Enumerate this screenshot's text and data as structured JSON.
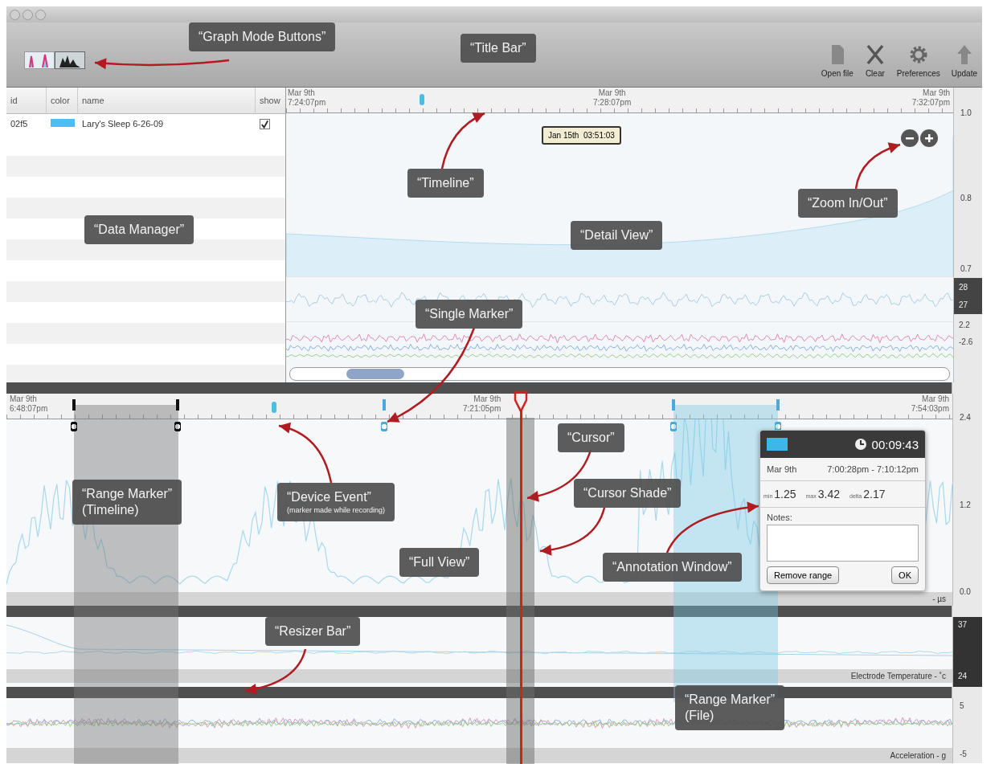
{
  "toolbar": {
    "graph_mode_buttons": [
      {
        "selected": false
      },
      {
        "selected": true
      }
    ],
    "buttons": [
      {
        "kind": "file",
        "label": "Open file"
      },
      {
        "kind": "clear",
        "label": "Clear"
      },
      {
        "kind": "gear",
        "label": "Preferences"
      },
      {
        "kind": "up",
        "label": "Update"
      }
    ]
  },
  "data_manager": {
    "columns": [
      "id",
      "color",
      "name",
      "show"
    ],
    "rows": [
      {
        "id": "02f5",
        "color": "#4cbfee",
        "name": "Lary's Sleep 6-26-09",
        "show": true
      }
    ]
  },
  "detail_view": {
    "timeline": [
      {
        "date": "Mar 9th",
        "time": "7:24:07pm"
      },
      {
        "date": "Mar 9th",
        "time": "7:28:07pm"
      },
      {
        "date": "Mar 9th",
        "time": "7:32:07pm"
      }
    ],
    "tooltip": "Jan 15th  03:51:03",
    "axis": [
      "1.0",
      "0.8",
      "0.7"
    ],
    "axis_dark": [
      "28",
      "27"
    ],
    "axis_low": [
      "2.2",
      "-2.6"
    ]
  },
  "full_view": {
    "timeline": [
      {
        "date": "Mar 9th",
        "time": "6:48:07pm"
      },
      {
        "date": "Mar 9th",
        "time": "7:21:05pm"
      },
      {
        "date": "Mar 9th",
        "time": "7:54:03pm"
      }
    ],
    "axis": [
      "2.4",
      "1.2",
      "0.0"
    ],
    "channel_label": "- µs"
  },
  "annotation_window": {
    "color": "#3fb6e8",
    "duration": "00:09:43",
    "date": "Mar 9th",
    "range": "7:00:28pm - 7:10:12pm",
    "stats": [
      {
        "label": "min",
        "value": "1.25"
      },
      {
        "label": "max",
        "value": "3.42"
      },
      {
        "label": "delta",
        "value": "2.17"
      }
    ],
    "notes_label": "Notes:",
    "buttons": [
      "Remove range",
      "OK"
    ]
  },
  "electrode_panel": {
    "axis": [
      "37",
      "24"
    ],
    "label": "Electrode Temperature - ˚c"
  },
  "acceleration_panel": {
    "axis": [
      "5",
      "-5"
    ],
    "label": "Acceleration - g"
  },
  "callouts": [
    {
      "text": "“Graph Mode Buttons”"
    },
    {
      "text": "“Title Bar”"
    },
    {
      "text": "“Timeline”"
    },
    {
      "text": "“Data Manager”"
    },
    {
      "text": "“Detail View”"
    },
    {
      "text": "“Zoom In/Out”"
    },
    {
      "text": "“Single Marker”"
    },
    {
      "text": "“Range Marker”",
      "note": "(Timeline)"
    },
    {
      "text": "“Device Event”",
      "note": "(marker made while recording)"
    },
    {
      "text": "“Full View”"
    },
    {
      "text": "“Cursor”"
    },
    {
      "text": "“Cursor Shade”"
    },
    {
      "text": "“Annotation Window”"
    },
    {
      "text": "“Resizer Bar”"
    },
    {
      "text": "“Range Marker”",
      "note": "(File)"
    }
  ]
}
